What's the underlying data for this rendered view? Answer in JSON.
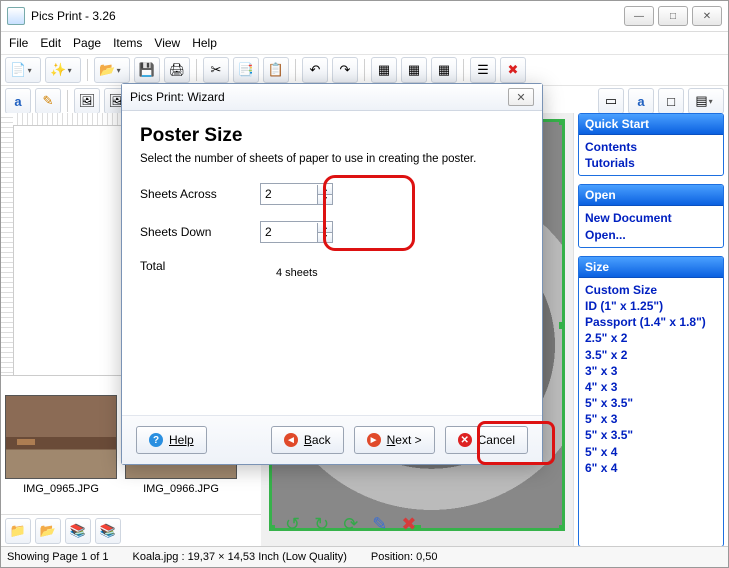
{
  "window": {
    "title": "Pics Print - 3.26"
  },
  "menu": {
    "file": "File",
    "edit": "Edit",
    "page": "Page",
    "items": "Items",
    "view": "View",
    "help": "Help"
  },
  "wizard": {
    "title": "Pics Print: Wizard",
    "heading": "Poster Size",
    "desc": "Select the number of sheets of paper to use in creating the poster.",
    "sheets_across_label": "Sheets Across",
    "sheets_across_value": "2",
    "sheets_down_label": "Sheets Down",
    "sheets_down_value": "2",
    "total_label": "Total",
    "total_value": "4 sheets",
    "help": "Help",
    "back": "< Back",
    "next": "Next >",
    "cancel": "Cancel"
  },
  "sidebar": {
    "quickstart": {
      "title": "Quick Start",
      "items": [
        "Contents",
        "Tutorials"
      ]
    },
    "open": {
      "title": "Open",
      "items": [
        "New Document",
        "Open..."
      ]
    },
    "size": {
      "title": "Size",
      "items": [
        "Custom Size",
        "ID (1\" x 1.25\")",
        "Passport (1.4\" x 1.8\")",
        "2.5\" x 2",
        "3.5\" x 2",
        "3\" x 3",
        "4\" x 3",
        "5\" x 3.5\"",
        "5\" x 3",
        "5\" x 3.5\"",
        "5\" x 4",
        "6\" x 4"
      ]
    }
  },
  "thumbs": {
    "a": "IMG_0965.JPG",
    "b": "IMG_0966.JPG"
  },
  "status": {
    "page": "Showing Page 1 of 1",
    "info": "Koala.jpg : 19,37 × 14,53 Inch (Low Quality)",
    "pos": "Position: 0,50"
  },
  "icons": {
    "min": "—",
    "max": "□",
    "close": "✕",
    "new": "📄",
    "wand": "✨",
    "open": "📂",
    "save": "💾",
    "print": "🖨",
    "cut": "✂",
    "copy": "📑",
    "paste": "📋",
    "undo": "↶",
    "redo": "↷",
    "grid": "▦",
    "del": "✖",
    "props": "☰",
    "page_a": "a",
    "rot_l": "↺",
    "rot_r": "↻",
    "pencil": "✎",
    "trash": "✖",
    "refresh": "⟳",
    "folder_up": "📁",
    "folder": "📂",
    "stack": "📚"
  }
}
